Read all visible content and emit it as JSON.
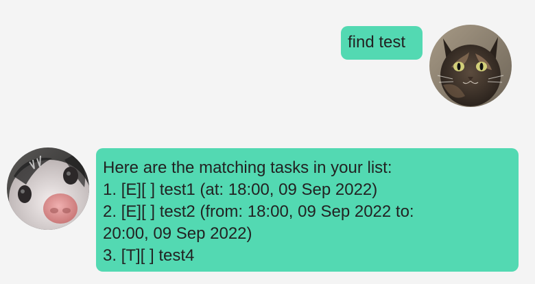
{
  "theme": {
    "background": "#f4f4f4",
    "bubble_color": "#53d9b2"
  },
  "user_message": {
    "text": "find test",
    "avatar": "cat-photo-avatar"
  },
  "bot_message": {
    "avatar": "possum-photo-avatar",
    "lines": [
      "Here are the matching tasks in your list:",
      "1. [E][ ] test1 (at: 18:00, 09 Sep 2022)",
      "2. [E][ ] test2 (from: 18:00, 09 Sep 2022 to:",
      "20:00, 09 Sep 2022)",
      "3. [T][ ] test4"
    ]
  }
}
